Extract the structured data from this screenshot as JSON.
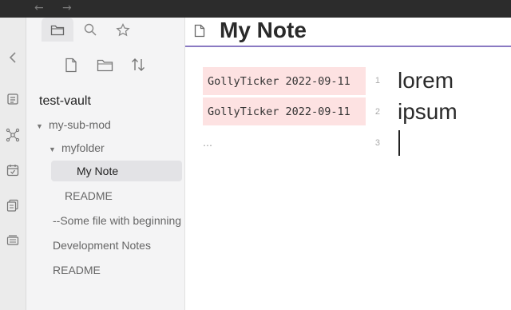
{
  "titlebar": {
    "back_icon": "arrow-left-icon",
    "forward_icon": "arrow-right-icon",
    "back_glyph": "←",
    "forward_glyph": "→"
  },
  "ribbon": {
    "items": [
      {
        "name": "collapse-icon"
      },
      {
        "name": "switcher-icon"
      },
      {
        "name": "graph-icon"
      },
      {
        "name": "daily-note-icon"
      },
      {
        "name": "templates-icon"
      },
      {
        "name": "slides-icon"
      }
    ]
  },
  "sidebar": {
    "tabs": [
      {
        "name": "file-explorer-icon"
      },
      {
        "name": "search-icon"
      },
      {
        "name": "bookmarks-icon"
      }
    ],
    "toolbar": [
      {
        "name": "new-note-icon"
      },
      {
        "name": "new-folder-icon"
      },
      {
        "name": "sort-icon"
      }
    ],
    "vault_name": "test-vault",
    "tree": [
      {
        "label": "my-sub-mod",
        "expanded": true
      },
      {
        "label": "myfolder",
        "expanded": true
      },
      {
        "label": "My Note",
        "active": true
      },
      {
        "label": "README"
      },
      {
        "label": "--Some file with beginning dashes"
      },
      {
        "label": "Development Notes"
      },
      {
        "label": "README"
      }
    ]
  },
  "note": {
    "title": "My Note",
    "lines": [
      {
        "blame": "GollyTicker 2022-09-11",
        "number": "1",
        "text": "lorem"
      },
      {
        "blame": "GollyTicker 2022-09-11",
        "number": "2",
        "text": "ipsum"
      },
      {
        "blame": "…",
        "number": "3",
        "text": ""
      }
    ]
  },
  "colors": {
    "accent": "#8a7ac2",
    "blame_bg": "#fde2e2",
    "titlebar_bg": "#2c2c2c"
  }
}
